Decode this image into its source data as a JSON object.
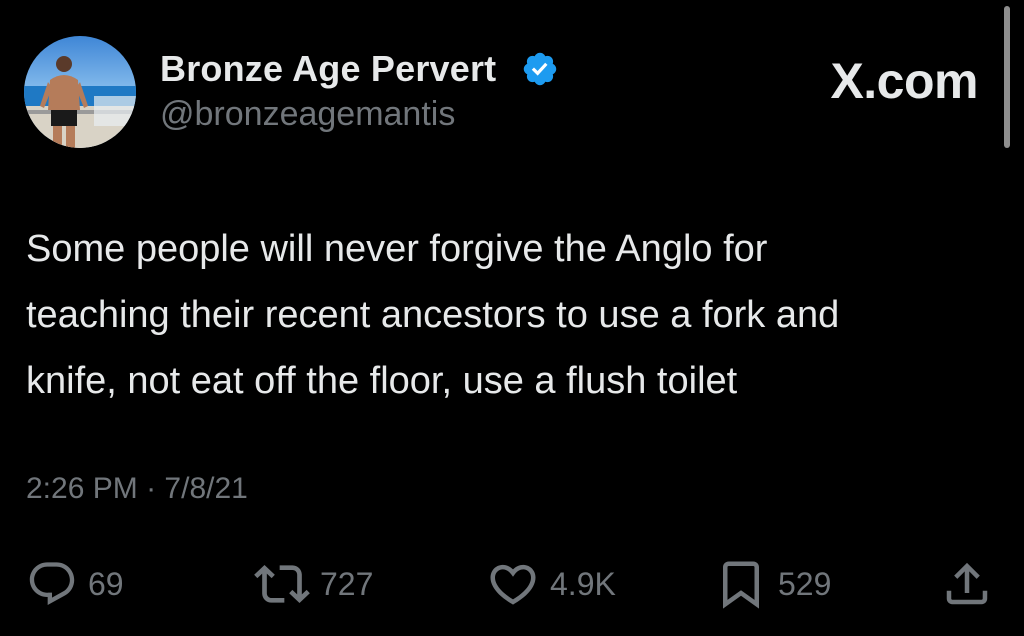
{
  "author": {
    "display_name": "Bronze Age Pervert",
    "handle": "@bronzeagemantis",
    "verified": true,
    "avatar_icon": "profile-photo-beach"
  },
  "brand": {
    "label": "X.com"
  },
  "tweet": {
    "lines": [
      "Some people will never forgive the Anglo for",
      "teaching their recent ancestors to use a fork and",
      "knife, not eat off the floor, use a flush toilet"
    ],
    "time": "2:26 PM",
    "separator": "·",
    "date": "7/8/21"
  },
  "actions": {
    "replies": {
      "icon": "reply-icon",
      "count": "69"
    },
    "reposts": {
      "icon": "repost-icon",
      "count": "727"
    },
    "likes": {
      "icon": "heart-icon",
      "count": "4.9K"
    },
    "bookmarks": {
      "icon": "bookmark-icon",
      "count": "529"
    },
    "share": {
      "icon": "share-icon"
    }
  },
  "colors": {
    "background": "#000000",
    "primary_text": "#e7e9ea",
    "secondary_text": "#71767b",
    "verified_badge": "#1d9bf0"
  }
}
